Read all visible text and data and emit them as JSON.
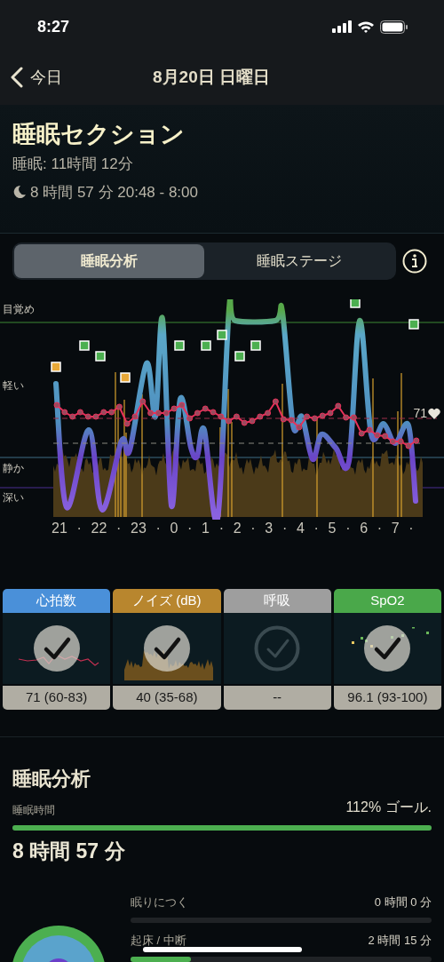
{
  "status_bar": {
    "time": "8:27"
  },
  "nav": {
    "back": "今日",
    "title": "8月20日 日曜日"
  },
  "header": {
    "title": "睡眠セクション",
    "sleep": "睡眠: 11時間 12分",
    "session": "8 時間 57 分 20:48 - 8:00"
  },
  "tabs": [
    {
      "label": "睡眠分析",
      "selected": true
    },
    {
      "label": "睡眠ステージ",
      "selected": false
    }
  ],
  "chart": {
    "stage_labels": [
      "目覚め",
      "軽い",
      "静か",
      "深い"
    ],
    "heart_rate": "71",
    "x_labels": [
      "21",
      "·",
      "22",
      "·",
      "23",
      "·",
      "0",
      "·",
      "1",
      "·",
      "2",
      "·",
      "3",
      "·",
      "4",
      "·",
      "5",
      "·",
      "6",
      "·",
      "7",
      "·"
    ]
  },
  "metrics": [
    {
      "title": "心拍数",
      "color": "#4a90d9",
      "kind": "heart",
      "active": true,
      "value": "71 (60-83)"
    },
    {
      "title": "ノイズ (dB)",
      "color": "#b8862e",
      "kind": "noise",
      "active": true,
      "value": "40 (35-68)"
    },
    {
      "title": "呼吸",
      "color": "#9e9e9e",
      "kind": "none",
      "active": false,
      "value": "--"
    },
    {
      "title": "SpO2",
      "color": "#4aa84a",
      "kind": "spo2",
      "active": true,
      "value": "96.1 (93-100)"
    }
  ],
  "analysis": {
    "title": "睡眠分析",
    "label": "睡眠時間",
    "goal": "112% ゴール.",
    "level": 1,
    "duration": "8 時間 57 分",
    "stages": [
      {
        "label": "眠りにつく",
        "value": "0 時間 0 分",
        "level": 0
      },
      {
        "label": "起床 / 中断",
        "value": "2 時間 15 分",
        "level": 0.2
      }
    ]
  }
}
